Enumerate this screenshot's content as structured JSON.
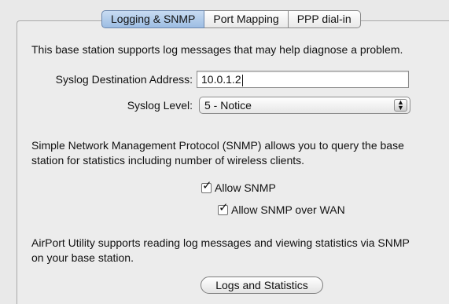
{
  "tabs": [
    {
      "label": "Logging & SNMP",
      "active": true
    },
    {
      "label": "Port Mapping",
      "active": false
    },
    {
      "label": "PPP dial-in",
      "active": false
    }
  ],
  "intro_text": "This base station supports log messages that may help diagnose a problem.",
  "syslog_address": {
    "label": "Syslog Destination Address:",
    "value": "10.0.1.2"
  },
  "syslog_level": {
    "label": "Syslog Level:",
    "value": "5 - Notice"
  },
  "snmp_text": [
    "Simple Network Management Protocol (SNMP) allows you to query the base",
    "station for statistics including number of wireless clients."
  ],
  "checkboxes": [
    {
      "label": "Allow SNMP",
      "checked": true
    },
    {
      "label": "Allow SNMP over WAN",
      "checked": true
    }
  ],
  "airport_text": [
    "AirPort Utility supports reading log messages and viewing statistics via SNMP",
    "on your base station."
  ],
  "logs_button": "Logs and Statistics",
  "icons": {
    "checkmark": "✓",
    "select_arrows": "up-down-arrows-icon"
  },
  "colors": {
    "active_tab": "#9dbde3",
    "background": "#ececec"
  }
}
